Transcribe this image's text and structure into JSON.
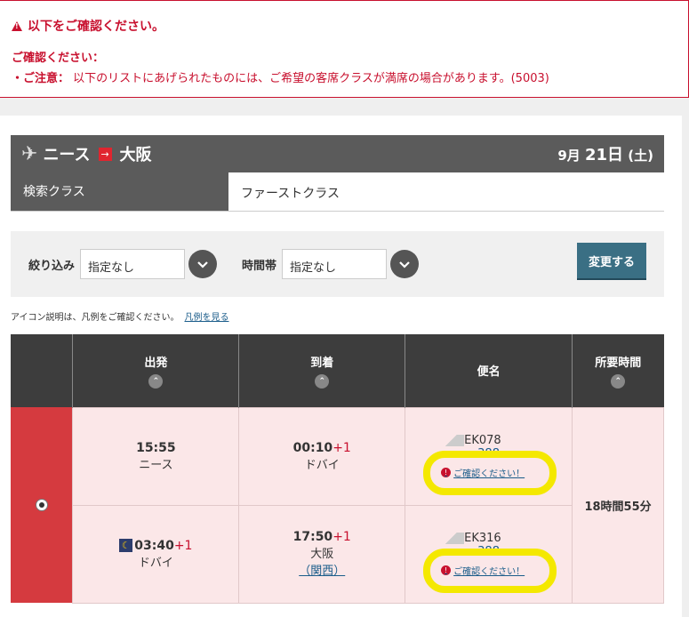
{
  "alert": {
    "heading": "以下をご確認ください。",
    "sub": "ご確認ください：",
    "note_label": "・ご注意：",
    "note_text": "以下のリストにあげられたものには、ご希望の客席クラスが満席の場合があります。(5003)"
  },
  "route": {
    "origin": "ニース",
    "arrow": "→",
    "destination": "大阪",
    "date_prefix": "9月",
    "date_day": "21日",
    "date_suffix": "(土)"
  },
  "class_row": {
    "label": "検索クラス",
    "value": "ファーストクラス"
  },
  "filter": {
    "narrow_label": "絞り込み",
    "narrow_value": "指定なし",
    "time_label": "時間帯",
    "time_value": "指定なし",
    "change_button": "変更する"
  },
  "legend": {
    "text": "アイコン説明は、凡例をご確認ください。",
    "link": "凡例を見る"
  },
  "table": {
    "headers": {
      "depart": "出発",
      "arrive": "到着",
      "flight": "便名",
      "duration": "所要時間"
    },
    "rows": [
      {
        "dep_time": "15:55",
        "dep_plus": "",
        "dep_place": "ニース",
        "arr_time": "00:10",
        "arr_plus": "+1",
        "arr_place": "ドバイ",
        "arr_place2": "",
        "flight_no": "EK078",
        "aircraft": "388",
        "confirm": "ご確認ください！"
      },
      {
        "dep_time": "03:40",
        "dep_plus": "+1",
        "dep_place": "ドバイ",
        "arr_time": "17:50",
        "arr_plus": "+1",
        "arr_place": "大阪",
        "arr_place2": "（関西）",
        "flight_no": "EK316",
        "aircraft": "388",
        "confirm": "ご確認ください！"
      }
    ],
    "duration": "18時間55分"
  },
  "colors": {
    "accent_red": "#c8102e",
    "header_gray": "#5b5b5b",
    "highlight_yellow": "#f4e800",
    "row_pink": "#fbe7e8"
  }
}
